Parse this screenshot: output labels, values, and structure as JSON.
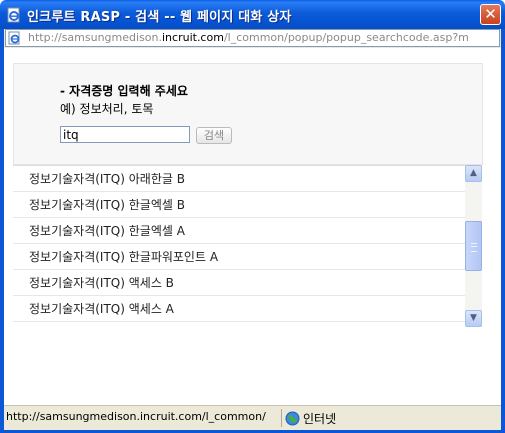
{
  "window": {
    "title": "인크루트 RASP - 검색 -- 웹 페이지 대화 상자",
    "close_symbol": "✕",
    "title_icon": "ie-page-icon"
  },
  "address": {
    "url_prefix": "http://samsungmedison.",
    "url_domain": "incruit.com",
    "url_suffix": "/l_common/popup/popup_searchcode.asp?m"
  },
  "search": {
    "heading": "- 자격증명 입력해 주세요",
    "example": "예) 정보처리, 토목",
    "input_value": "itq",
    "button_label": "검색"
  },
  "results": [
    "정보기술자격(ITQ) 아래한글 B",
    "정보기술자격(ITQ) 한글엑셀 B",
    "정보기술자격(ITQ) 한글엑셀 A",
    "정보기술자격(ITQ) 한글파워포인트 A",
    "정보기술자격(ITQ) 액세스 B",
    "정보기술자격(ITQ) 액세스 A"
  ],
  "scrollbar": {
    "up_symbol": "▲",
    "down_symbol": "▼"
  },
  "status": {
    "url": "http://samsungmedison.incruit.com/l_common/",
    "zone_label": "인터넷"
  },
  "colors": {
    "title_bar": "#0b5bd9",
    "close_button": "#c9411c",
    "frame": "#0b57d5"
  }
}
